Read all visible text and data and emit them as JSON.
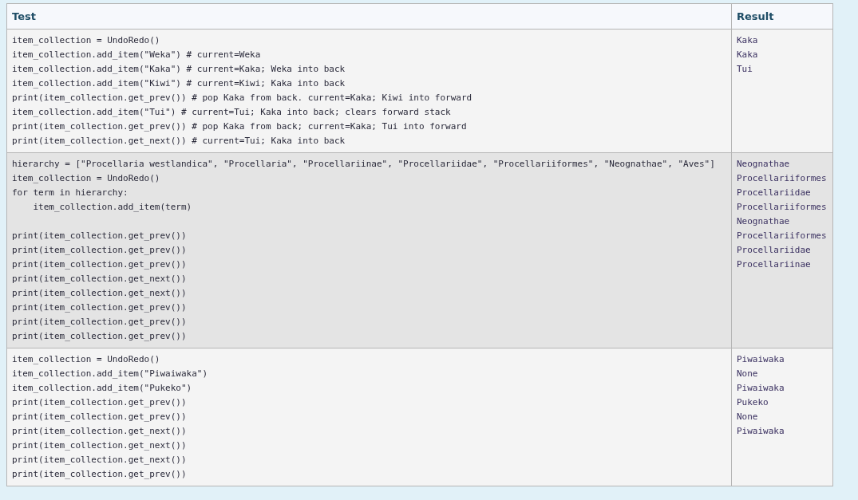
{
  "table": {
    "columns": [
      "Test",
      "Result"
    ],
    "rows": [
      {
        "test": "item_collection = UndoRedo()\nitem_collection.add_item(\"Weka\") # current=Weka\nitem_collection.add_item(\"Kaka\") # current=Kaka; Weka into back\nitem_collection.add_item(\"Kiwi\") # current=Kiwi; Kaka into back\nprint(item_collection.get_prev()) # pop Kaka from back. current=Kaka; Kiwi into forward\nitem_collection.add_item(\"Tui\") # current=Tui; Kaka into back; clears forward stack\nprint(item_collection.get_prev()) # pop Kaka from back; current=Kaka; Tui into forward\nprint(item_collection.get_next()) # current=Tui; Kaka into back",
        "result": "Kaka\nKaka\nTui",
        "selected": false
      },
      {
        "test": "hierarchy = [\"Procellaria westlandica\", \"Procellaria\", \"Procellariinae\", \"Procellariidae\", \"Procellariiformes\", \"Neognathae\", \"Aves\"]\nitem_collection = UndoRedo()\nfor term in hierarchy:\n    item_collection.add_item(term)\n\nprint(item_collection.get_prev())\nprint(item_collection.get_prev())\nprint(item_collection.get_prev())\nprint(item_collection.get_next())\nprint(item_collection.get_next())\nprint(item_collection.get_prev())\nprint(item_collection.get_prev())\nprint(item_collection.get_prev())",
        "result": "Neognathae\nProcellariiformes\nProcellariidae\nProcellariiformes\nNeognathae\nProcellariiformes\nProcellariidae\nProcellariinae",
        "selected": true
      },
      {
        "test": "item_collection = UndoRedo()\nitem_collection.add_item(\"Piwaiwaka\")\nitem_collection.add_item(\"Pukeko\")\nprint(item_collection.get_prev())\nprint(item_collection.get_prev())\nprint(item_collection.get_next())\nprint(item_collection.get_next())\nprint(item_collection.get_next())\nprint(item_collection.get_prev())",
        "result": "Piwaiwaka\nNone\nPiwaiwaka\nPukeko\nNone\nPiwaiwaka",
        "selected": false
      }
    ]
  }
}
